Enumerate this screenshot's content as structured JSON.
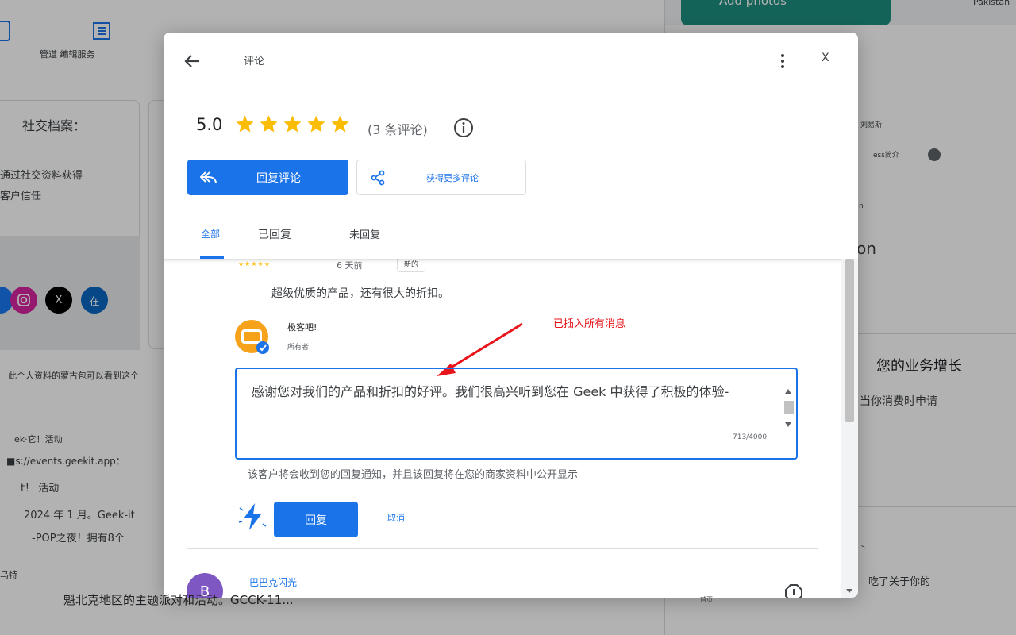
{
  "background": {
    "top_nav_label": "管道 编辑服务",
    "social_profile_title": "社交档案：",
    "social_profile_line1": "通过社交资料获得",
    "social_profile_line2": "客户信任",
    "social_x_label": "X",
    "social_in_label": "在",
    "mongol_note": "此个人资料的蒙古包可以看到这个",
    "post_line1": "ek·它！活动",
    "post_line2": "■s://events.geekit.app：",
    "post_line3": "t！ 活动",
    "post_line4": "2024 年 1 月。Geek-it",
    "post_line5": "-POP之夜！拥有8个",
    "post_line6": "乌特",
    "post_line7": "魁北克地区的主题派对和活动。GCCK-11...",
    "map_label_pakistan": "Pakistan",
    "map_label_city": "刘易斯",
    "ess_intro": "ess简介",
    "right_partial_n": "n",
    "right_partial_on": "on",
    "growth_title": "您的业务增长",
    "growth_sub": "当你消费时申请",
    "right_s": "s",
    "about_you": "吃了关于你的",
    "home_label": "首页",
    "add_photos": "Add photos"
  },
  "dialog": {
    "title": "评论",
    "close_label": "X",
    "rating": "5.0",
    "star_count": 5,
    "star_color": "#fbbc04",
    "review_count": "(3 条评论)",
    "reply_reviews_button": "回复评论",
    "more_reviews_button": "获得更多评论",
    "tabs": [
      {
        "label": "全部",
        "active": true
      },
      {
        "label": "已回复",
        "active": false
      },
      {
        "label": "未回复",
        "active": false
      }
    ],
    "review": {
      "stars_text": "★★★★★",
      "time_ago": "6 天前",
      "badge": "新的",
      "text": "超级优质的产品，还有很大的折扣。"
    },
    "owner": {
      "name": "极客吧!",
      "role": "所有者"
    },
    "annotation": "已插入所有消息",
    "annotation_color": "#e8141a",
    "reply": {
      "text": "感谢您对我们的产品和折扣的好评。我们很高兴听到您在 Geek 中获得了积极的体验-",
      "char_count": "713/4000"
    },
    "notice": "该客户将会收到您的回复通知，并且该回复将在您的商家资料中公开显示",
    "reply_button": "回复",
    "cancel_button": "取消",
    "next_review": {
      "avatar_letter": "B",
      "name": "巴巴克闪光"
    },
    "accent_color": "#1a73e8"
  }
}
